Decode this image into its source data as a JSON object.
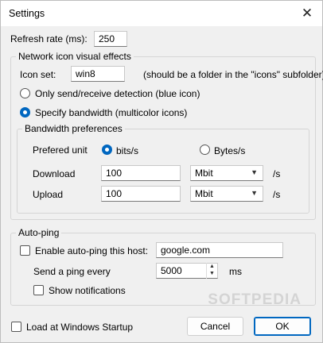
{
  "window": {
    "title": "Settings",
    "close_glyph": "✕"
  },
  "refresh": {
    "label": "Refresh rate (ms):",
    "value": "250"
  },
  "network_group": {
    "label": "Network icon visual effects",
    "icon_set_label": "Icon set:",
    "icon_set_value": "win8",
    "icon_set_hint": "(should be a folder in the \"icons\" subfolder)",
    "mode_options": [
      {
        "label": "Only send/receive detection (blue icon)",
        "selected": false
      },
      {
        "label": "Specify bandwidth (multicolor icons)",
        "selected": true
      }
    ]
  },
  "bandwidth_group": {
    "label": "Bandwidth preferences",
    "unit_label": "Prefered unit",
    "unit_options": [
      {
        "label": "bits/s",
        "selected": true
      },
      {
        "label": "Bytes/s",
        "selected": false
      }
    ],
    "download": {
      "label": "Download",
      "value": "100",
      "unit": "Mbit",
      "suffix": "/s"
    },
    "upload": {
      "label": "Upload",
      "value": "100",
      "unit": "Mbit",
      "suffix": "/s"
    }
  },
  "autoping_group": {
    "label": "Auto-ping",
    "enable_label": "Enable auto-ping this host:",
    "enable_checked": false,
    "host_value": "google.com",
    "interval_label": "Send a ping every",
    "interval_value": "5000",
    "interval_unit": "ms",
    "notifications_label": "Show notifications",
    "notifications_checked": false
  },
  "footer": {
    "startup_label": "Load at Windows Startup",
    "startup_checked": false,
    "cancel_label": "Cancel",
    "ok_label": "OK"
  },
  "watermark": "SOFTPEDIA"
}
